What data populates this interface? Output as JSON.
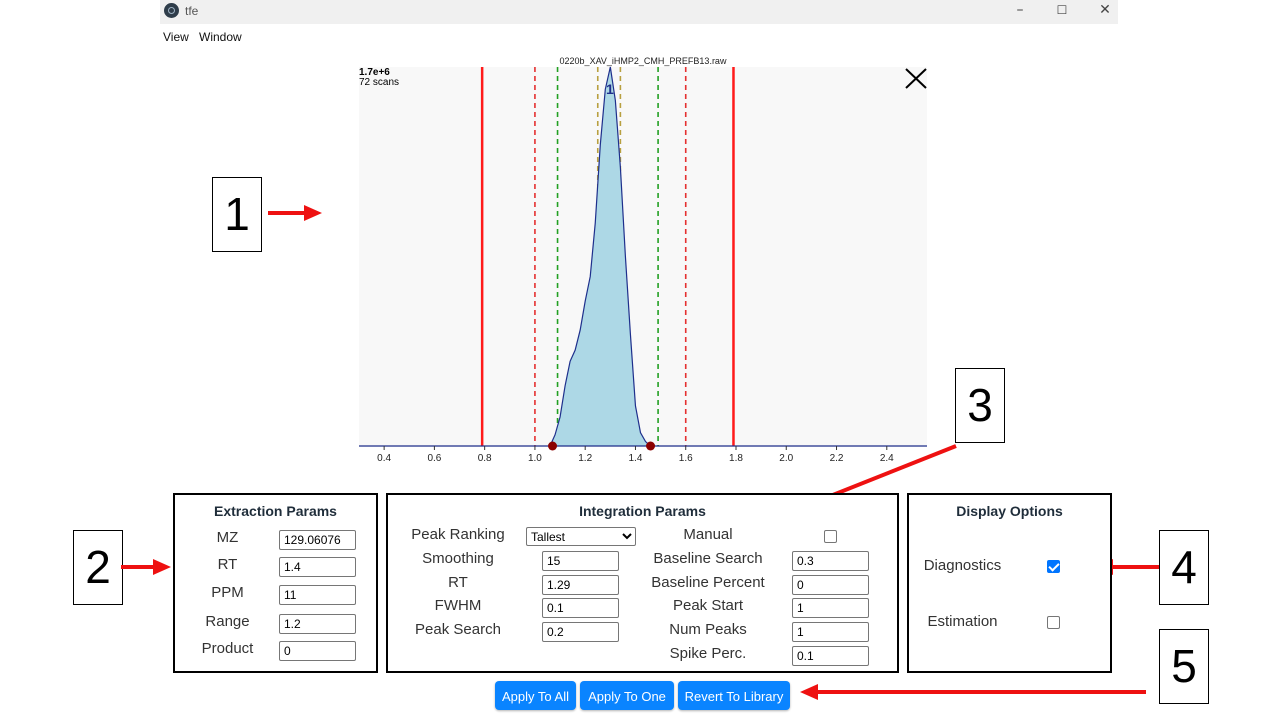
{
  "window": {
    "title": "tfe",
    "menu": [
      "View",
      "Window"
    ],
    "controls": {
      "minimize": "–",
      "maximize": "☐",
      "close": "✕"
    }
  },
  "chart": {
    "title": "0220b_XAV_iHMP2_CMH_PREFB13.raw",
    "intensity_label": "1.7e+6",
    "scans_label": "72 scans",
    "peak_label": "1"
  },
  "chart_data": {
    "type": "area",
    "xlim": [
      0.3,
      2.56
    ],
    "ylim": [
      0,
      1700000.0
    ],
    "x_ticks": [
      0.4,
      0.6,
      0.8,
      1.0,
      1.2,
      1.4,
      1.6,
      1.8,
      2.0,
      2.2,
      2.4
    ],
    "x_tick_labels": [
      "0.4",
      "0.6",
      "0.8",
      "1.0",
      "1.2",
      "1.4",
      "1.6",
      "1.8",
      "2.0",
      "2.2",
      "2.4"
    ],
    "x": [
      0.3,
      1.06,
      1.08,
      1.1,
      1.12,
      1.14,
      1.16,
      1.18,
      1.2,
      1.22,
      1.24,
      1.26,
      1.28,
      1.3,
      1.32,
      1.34,
      1.36,
      1.38,
      1.4,
      1.42,
      1.44,
      1.46,
      2.56
    ],
    "y": [
      0,
      0,
      50000,
      130000,
      270000,
      380000,
      430000,
      520000,
      650000,
      760000,
      1000000,
      1350000,
      1600000,
      1700000,
      1550000,
      1250000,
      850000,
      500000,
      180000,
      60000,
      20000,
      0,
      0
    ],
    "vertical_lines": [
      {
        "x": 0.79,
        "style": "solid",
        "color": "#ff1a1a"
      },
      {
        "x": 1.79,
        "style": "solid",
        "color": "#ff1a1a"
      },
      {
        "x": 1.0,
        "style": "dashed",
        "color": "#e53030"
      },
      {
        "x": 1.6,
        "style": "dashed",
        "color": "#e53030"
      },
      {
        "x": 1.09,
        "style": "dashed",
        "color": "#22a022"
      },
      {
        "x": 1.49,
        "style": "dashed",
        "color": "#22a022"
      },
      {
        "x": 1.25,
        "style": "dashed",
        "color": "#b8a040"
      },
      {
        "x": 1.34,
        "style": "dashed",
        "color": "#b8a040"
      }
    ],
    "markers": [
      {
        "x": 1.07,
        "y": 0
      },
      {
        "x": 1.46,
        "y": 0
      }
    ],
    "colors": {
      "fill": "#add8e6",
      "line": "#1e2f8c",
      "marker": "#8b0000",
      "background": "#f8f8f8"
    }
  },
  "annotations": {
    "c1": "1",
    "c2": "2",
    "c3": "3",
    "c4": "4",
    "c5": "5"
  },
  "extraction": {
    "title": "Extraction Params",
    "fields": [
      {
        "label": "MZ",
        "value": "129.06076"
      },
      {
        "label": "RT",
        "value": "1.4"
      },
      {
        "label": "PPM",
        "value": "11"
      },
      {
        "label": "Range",
        "value": "1.2"
      },
      {
        "label": "Product",
        "value": "0"
      }
    ]
  },
  "integration": {
    "title": "Integration Params",
    "peak_ranking": {
      "label": "Peak Ranking",
      "selected": "Tallest"
    },
    "left": [
      {
        "label": "Smoothing",
        "value": "15"
      },
      {
        "label": "RT",
        "value": "1.29"
      },
      {
        "label": "FWHM",
        "value": "0.1"
      },
      {
        "label": "Peak Search",
        "value": "0.2"
      }
    ],
    "manual": {
      "label": "Manual",
      "checked": false
    },
    "right": [
      {
        "label": "Baseline Search",
        "value": "0.3"
      },
      {
        "label": "Baseline Percent",
        "value": "0"
      },
      {
        "label": "Peak Start",
        "value": "1"
      },
      {
        "label": "Num Peaks",
        "value": "1"
      },
      {
        "label": "Spike Perc.",
        "value": "0.1"
      }
    ]
  },
  "display": {
    "title": "Display Options",
    "diagnostics": {
      "label": "Diagnostics",
      "checked": true
    },
    "estimation": {
      "label": "Estimation",
      "checked": false
    }
  },
  "buttons": {
    "apply_all": "Apply To All",
    "apply_one": "Apply To One",
    "revert": "Revert To Library"
  },
  "colors": {
    "accent": "#0a84ff",
    "arrow": "#ee1111"
  }
}
